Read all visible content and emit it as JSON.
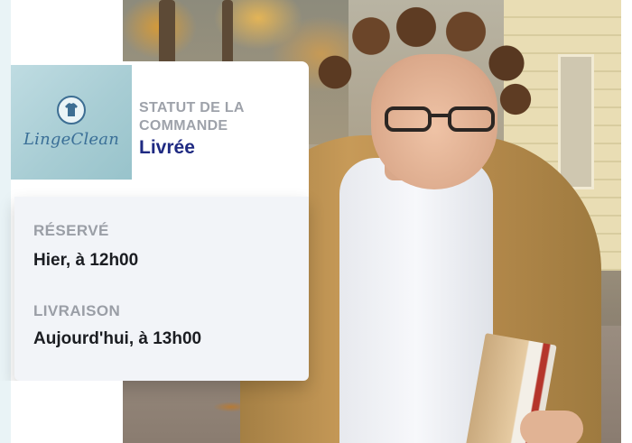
{
  "brand": {
    "name": "LingeClean",
    "logo_icon": "shirt-icon",
    "colors": {
      "logo_text": "#3a6f97",
      "logo_bg": "#a8cdd4"
    }
  },
  "order_status": {
    "label": "STATUT DE LA COMMANDE",
    "value": "Livrée",
    "value_color": "#1f2a82"
  },
  "details": {
    "reserved_label": "RÉSERVÉ",
    "reserved_value": "Hier, à  12h00",
    "delivery_label": "LIVRAISON",
    "delivery_value": "Aujourd'hui, à 13h00"
  },
  "background_photo": "man-with-glasses-holding-books-photo"
}
